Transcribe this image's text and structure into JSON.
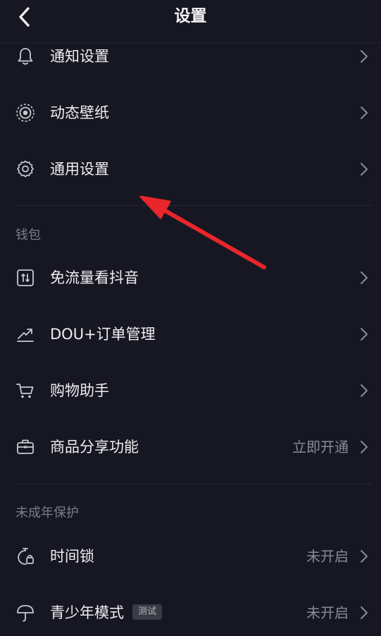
{
  "header": {
    "title": "设置"
  },
  "rows": {
    "notifications": {
      "label": "通知设置"
    },
    "wallpaper": {
      "label": "动态壁纸"
    },
    "general": {
      "label": "通用设置"
    },
    "free_data": {
      "label": "免流量看抖音"
    },
    "dou_orders": {
      "label": "DOU+订单管理"
    },
    "shopping": {
      "label": "购物助手"
    },
    "product_share": {
      "label": "商品分享功能",
      "value": "立即开通"
    },
    "time_lock": {
      "label": "时间锁",
      "value": "未开启"
    },
    "teen_mode": {
      "label": "青少年模式",
      "badge": "测试",
      "value": "未开启"
    }
  },
  "sections": {
    "wallet": "钱包",
    "minor_protection": "未成年保护"
  },
  "colors": {
    "background": "#161722",
    "annotation_arrow": "#e8262b"
  }
}
